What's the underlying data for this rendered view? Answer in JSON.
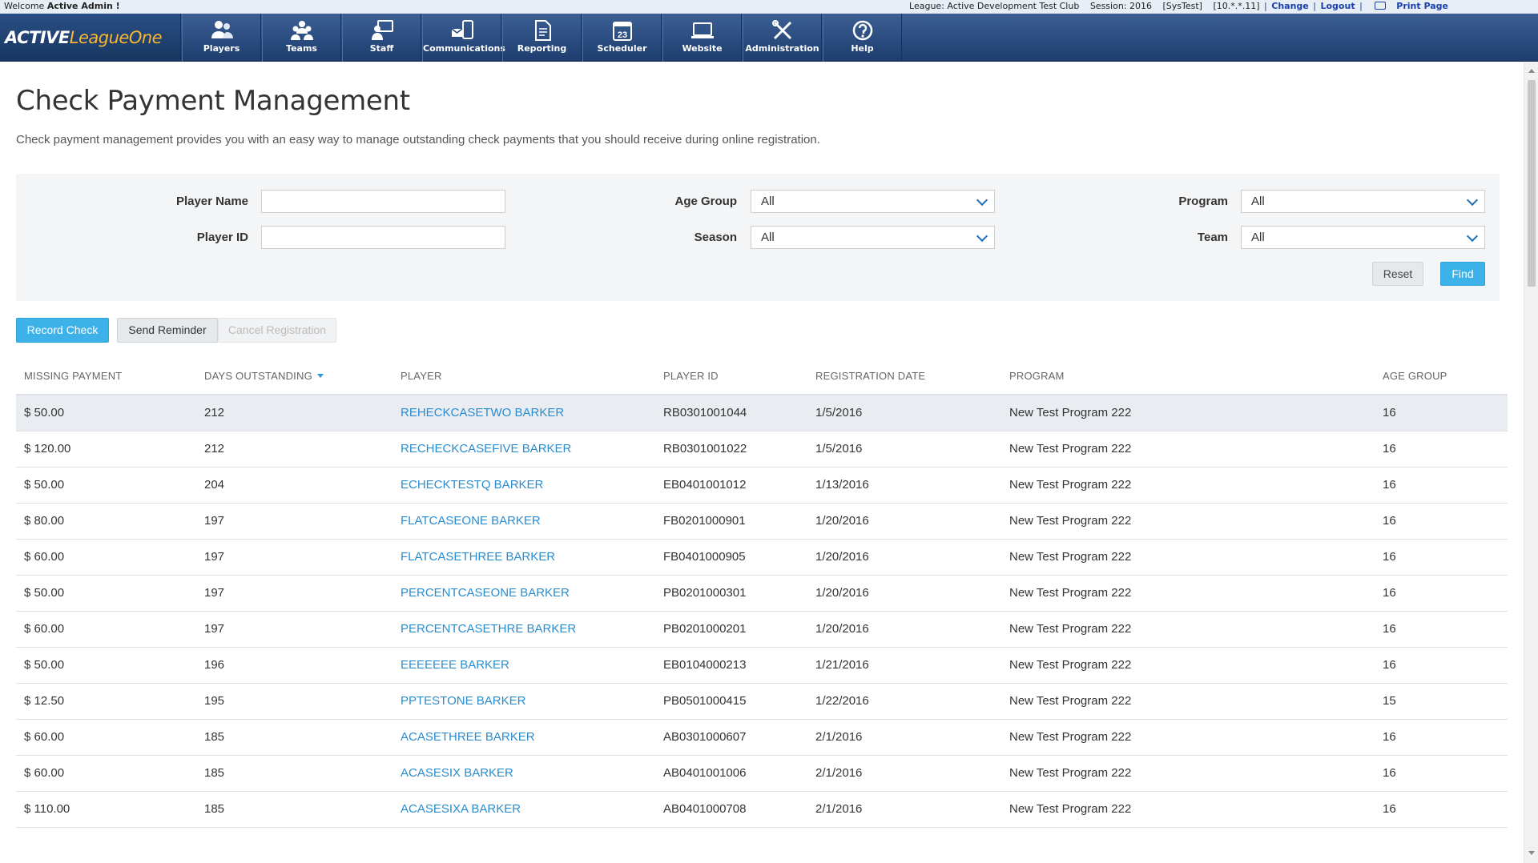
{
  "topbar": {
    "welcome_prefix": "Welcome",
    "welcome_user": "Active Admin !",
    "league": "League: Active Development Test Club",
    "session": "Session: 2016",
    "systest": "[SysTest]",
    "ip": "[10.*.*.11]",
    "change": "Change",
    "logout": "Logout",
    "print": "Print Page",
    "sep": "|"
  },
  "logo": {
    "part1": "ACTIVE",
    "part2": "LeagueOne"
  },
  "nav": [
    {
      "label": "Players",
      "icon": "players-icon"
    },
    {
      "label": "Teams",
      "icon": "teams-icon"
    },
    {
      "label": "Staff",
      "icon": "staff-icon"
    },
    {
      "label": "Communications",
      "icon": "communications-icon"
    },
    {
      "label": "Reporting",
      "icon": "reporting-icon"
    },
    {
      "label": "Scheduler",
      "icon": "scheduler-icon"
    },
    {
      "label": "Website",
      "icon": "website-icon"
    },
    {
      "label": "Administration",
      "icon": "administration-icon"
    },
    {
      "label": "Help",
      "icon": "help-icon"
    }
  ],
  "scheduler_day": "23",
  "page": {
    "title": "Check Payment Management",
    "description": "Check payment management provides you with an easy way to manage outstanding check payments that you should receive during online registration."
  },
  "filters": {
    "player_name_label": "Player Name",
    "player_name_value": "",
    "player_id_label": "Player ID",
    "player_id_value": "",
    "age_group_label": "Age Group",
    "age_group_value": "All",
    "season_label": "Season",
    "season_value": "All",
    "program_label": "Program",
    "program_value": "All",
    "team_label": "Team",
    "team_value": "All",
    "reset_label": "Reset",
    "find_label": "Find"
  },
  "actions": {
    "record_check": "Record Check",
    "send_reminder": "Send Reminder",
    "cancel_registration": "Cancel Registration"
  },
  "table": {
    "columns": [
      "MISSING PAYMENT",
      "DAYS OUTSTANDING",
      "PLAYER",
      "PLAYER ID",
      "REGISTRATION DATE",
      "PROGRAM",
      "AGE GROUP"
    ],
    "sorted_column": "DAYS OUTSTANDING",
    "rows": [
      {
        "payment": "$ 50.00",
        "days": "212",
        "player": "REHECKCASETWO BARKER",
        "player_id": "RB0301001044",
        "date": "1/5/2016",
        "program": "New Test Program 222",
        "age": "16"
      },
      {
        "payment": "$ 120.00",
        "days": "212",
        "player": "RECHECKCASEFIVE BARKER",
        "player_id": "RB0301001022",
        "date": "1/5/2016",
        "program": "New Test Program 222",
        "age": "16"
      },
      {
        "payment": "$ 50.00",
        "days": "204",
        "player": "ECHECKTESTQ BARKER",
        "player_id": "EB0401001012",
        "date": "1/13/2016",
        "program": "New Test Program 222",
        "age": "16"
      },
      {
        "payment": "$ 80.00",
        "days": "197",
        "player": "FLATCASEONE BARKER",
        "player_id": "FB0201000901",
        "date": "1/20/2016",
        "program": "New Test Program 222",
        "age": "16"
      },
      {
        "payment": "$ 60.00",
        "days": "197",
        "player": "FLATCASETHREE BARKER",
        "player_id": "FB0401000905",
        "date": "1/20/2016",
        "program": "New Test Program 222",
        "age": "16"
      },
      {
        "payment": "$ 50.00",
        "days": "197",
        "player": "PERCENTCASEONE BARKER",
        "player_id": "PB0201000301",
        "date": "1/20/2016",
        "program": "New Test Program 222",
        "age": "16"
      },
      {
        "payment": "$ 60.00",
        "days": "197",
        "player": "PERCENTCASETHRE BARKER",
        "player_id": "PB0201000201",
        "date": "1/20/2016",
        "program": "New Test Program 222",
        "age": "16"
      },
      {
        "payment": "$ 50.00",
        "days": "196",
        "player": "EEEEEEE BARKER",
        "player_id": "EB0104000213",
        "date": "1/21/2016",
        "program": "New Test Program 222",
        "age": "16"
      },
      {
        "payment": "$ 12.50",
        "days": "195",
        "player": "PPTESTONE BARKER",
        "player_id": "PB0501000415",
        "date": "1/22/2016",
        "program": "New Test Program 222",
        "age": "15"
      },
      {
        "payment": "$ 60.00",
        "days": "185",
        "player": "ACASETHREE BARKER",
        "player_id": "AB0301000607",
        "date": "2/1/2016",
        "program": "New Test Program 222",
        "age": "16"
      },
      {
        "payment": "$ 60.00",
        "days": "185",
        "player": "ACASESIX BARKER",
        "player_id": "AB0401001006",
        "date": "2/1/2016",
        "program": "New Test Program 222",
        "age": "16"
      },
      {
        "payment": "$ 110.00",
        "days": "185",
        "player": "ACASESIXA BARKER",
        "player_id": "AB0401000708",
        "date": "2/1/2016",
        "program": "New Test Program 222",
        "age": "16"
      }
    ]
  },
  "colors": {
    "nav_bg": "#2a4a7e",
    "accent": "#3db2e8",
    "link": "#2a8ccf",
    "logo_orange": "#f7b731"
  }
}
